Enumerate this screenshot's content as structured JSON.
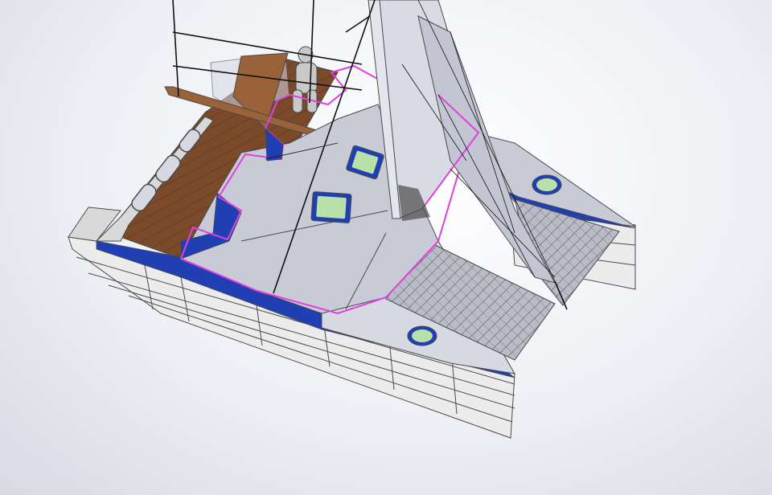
{
  "viewport": {
    "background_top": "#ffffff",
    "background_bottom": "#d7dae3"
  },
  "model": {
    "subject": "catamaran-cad-model",
    "colors": {
      "hull_side": "#ececec",
      "hull_side_shade": "#d9d9d9",
      "hull_lines": "#4a4a4a",
      "sheer_stripe": "#1f3fb3",
      "deck": "#c8cad6",
      "deck_light": "#d6d8e2",
      "deck_outline": "#e040e0",
      "wood_deck": "#7a4a2a",
      "wood_deck_light": "#9a6238",
      "trampoline": "#b9bcc6",
      "trampoline_mesh": "#5a5a66",
      "hatch_glass": "#b8e0a8",
      "hatch_frame": "#1f3fb3",
      "sail": "#d9dbe4",
      "sail_shadow": "#c3c6d2",
      "mast": "#e4e6ee",
      "rigging": "#111111",
      "figure": "#c9c9c9"
    }
  }
}
